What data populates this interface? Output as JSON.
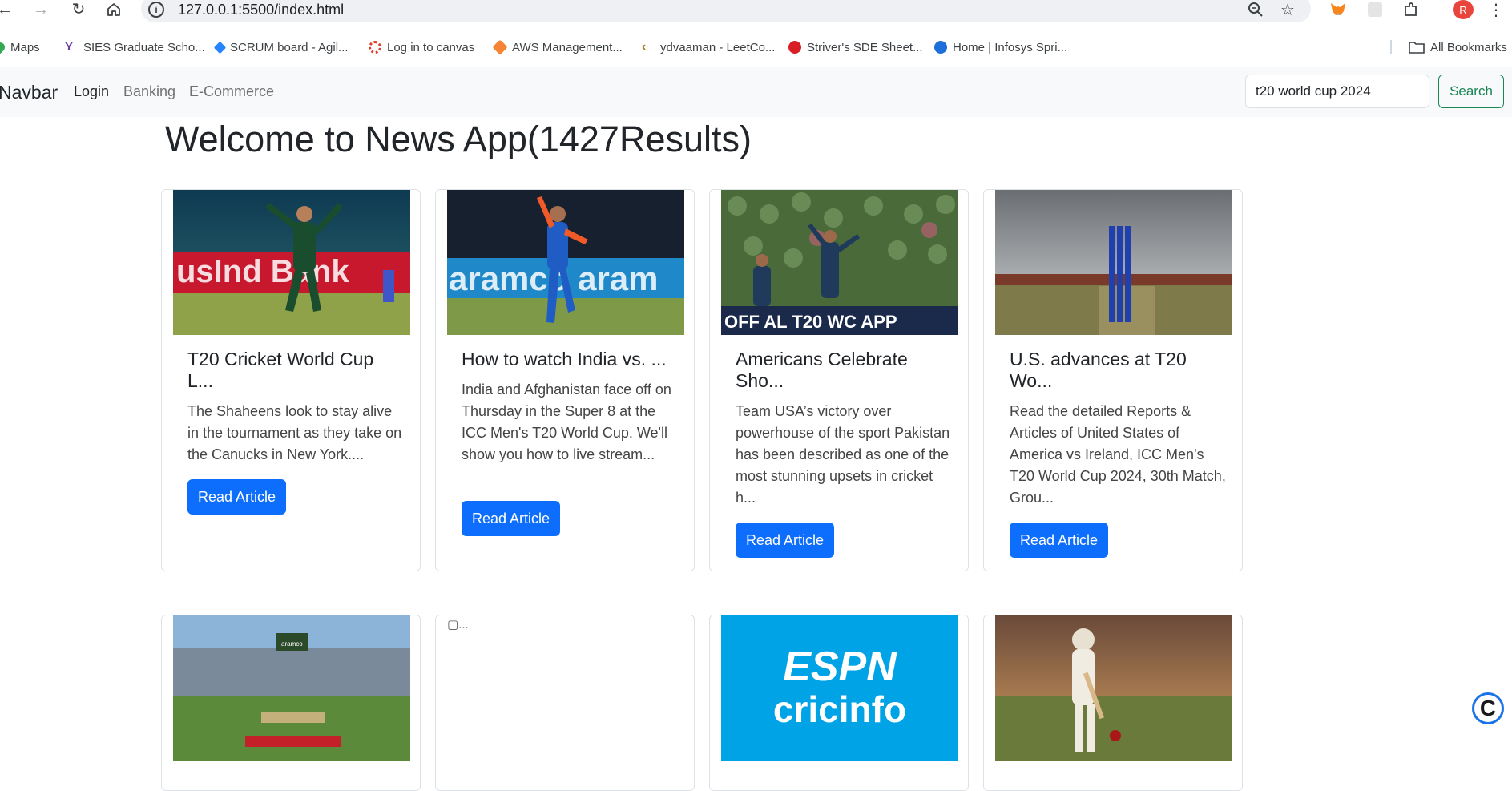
{
  "browser": {
    "url": "127.0.0.1:5500/index.html",
    "bookmarks": [
      {
        "label": "Maps",
        "icon": "maps-pin-icon",
        "color": "#34a853"
      },
      {
        "label": "SIES Graduate Scho...",
        "icon": "sies-logo-icon",
        "color": "#6a3fa0"
      },
      {
        "label": "SCRUM board - Agil...",
        "icon": "jira-diamond-icon",
        "color": "#2684ff"
      },
      {
        "label": "Log in to canvas",
        "icon": "canvas-logo-icon",
        "color": "#e13f2b"
      },
      {
        "label": "AWS Management...",
        "icon": "aws-cube-icon",
        "color": "#f58534"
      },
      {
        "label": "ydvaaman - LeetCo...",
        "icon": "leetcode-icon",
        "color": "#ffa116"
      },
      {
        "label": "Striver's SDE Sheet...",
        "icon": "tuf-logo-icon",
        "color": "#d91f26"
      },
      {
        "label": "Home | Infosys Spri...",
        "icon": "infosys-logo-icon",
        "color": "#1e6fd9"
      }
    ],
    "all_bookmarks": "All Bookmarks",
    "profile_initial": "R"
  },
  "navbar": {
    "brand": "Navbar",
    "links": [
      "Login",
      "Banking",
      "E-Commerce"
    ],
    "search_value": "t20 world cup 2024",
    "search_button": "Search"
  },
  "main": {
    "title": "Welcome to News App(1427Results)",
    "read_label": "Read Article",
    "cards": [
      {
        "title": "T20 Cricket World Cup L...",
        "text": "The Shaheens look to stay alive in the tournament as they take on the Canucks in New York...."
      },
      {
        "title": "How to watch India vs. ...",
        "text": "India and Afghanistan face off on Thursday in the Super 8 at the ICC Men's T20 World Cup. We'll show you how to live stream..."
      },
      {
        "title": "Americans Celebrate Sho...",
        "text": "Team USA’s victory over powerhouse of the sport Pakistan has been described as one of the most stunning upsets in cricket h..."
      },
      {
        "title": "U.S. advances at T20 Wo...",
        "text": "Read the detailed Reports & Articles of United States of America vs Ireland, ICC Men's T20 World Cup 2024, 30th Match, Grou..."
      }
    ],
    "row2": {
      "broken_alt": "...",
      "espn_line1": "ESPN",
      "espn_line2": "cricinfo"
    },
    "image_texts": {
      "banner1": "usInd Bank",
      "banner2": "aramco aram",
      "banner3": "OFF AL T20 WC APP",
      "stadium_board": "aramco"
    }
  },
  "colors": {
    "primary": "#0d6efd",
    "success": "#198754",
    "navbar_bg": "#f8f9fa"
  }
}
